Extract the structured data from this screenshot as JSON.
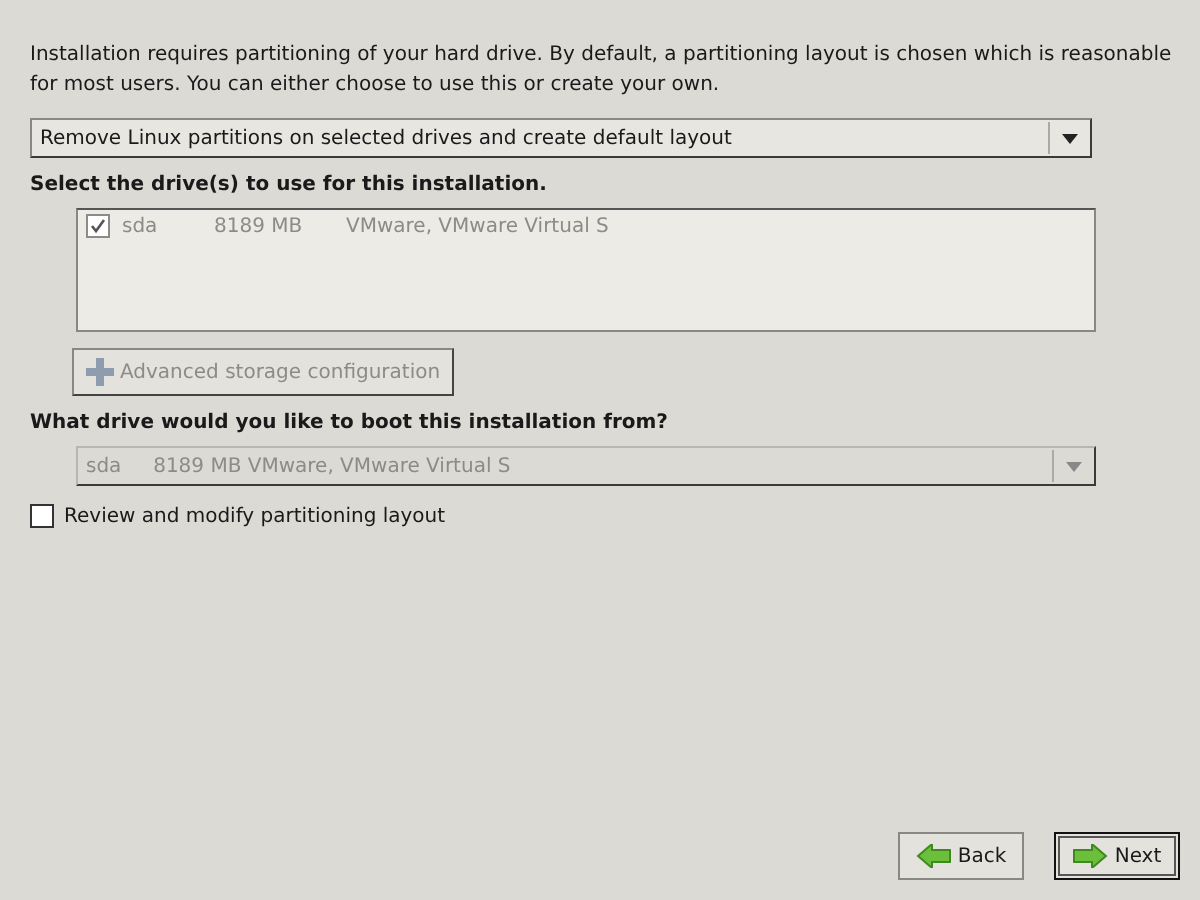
{
  "intro": "Installation requires partitioning of your hard drive.  By default, a partitioning layout is chosen which is reasonable for most users.  You can either choose to use this or create your own.",
  "layout_select": {
    "value": "Remove Linux partitions on selected drives and create default layout",
    "disabled": false
  },
  "drives_heading": "Select the drive(s) to use for this installation.",
  "drives": [
    {
      "checked": true,
      "name": "sda",
      "size": "8189 MB",
      "model": "VMware, VMware Virtual S"
    }
  ],
  "advanced_button": {
    "label": "Advanced storage configuration",
    "disabled": true
  },
  "boot_heading": "What drive would you like to boot this installation from?",
  "boot_select": {
    "value": "sda     8189 MB VMware, VMware Virtual S",
    "disabled": true
  },
  "review": {
    "label": "Review and modify partitioning layout",
    "checked": false
  },
  "buttons": [
    {
      "kind": "back",
      "label": "Back",
      "focused": false
    },
    {
      "kind": "next",
      "label": "Next",
      "focused": true
    }
  ]
}
